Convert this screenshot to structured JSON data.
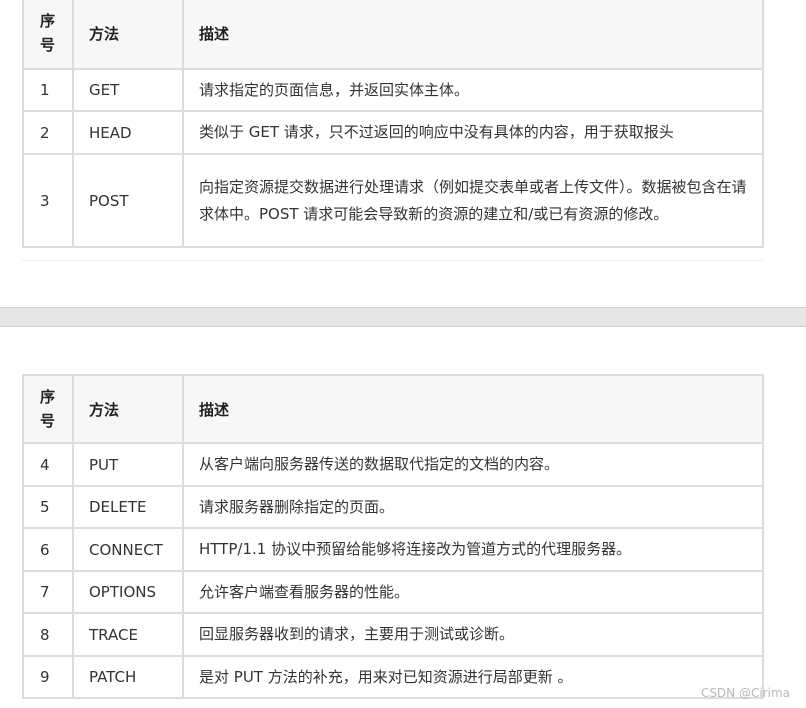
{
  "headers": {
    "num": "序号",
    "method": "方法",
    "desc": "描述"
  },
  "table1": {
    "rows": [
      {
        "num": "1",
        "method": "GET",
        "desc": "请求指定的页面信息，并返回实体主体。"
      },
      {
        "num": "2",
        "method": "HEAD",
        "desc": "类似于 GET 请求，只不过返回的响应中没有具体的内容，用于获取报头"
      },
      {
        "num": "3",
        "method": "POST",
        "desc": "向指定资源提交数据进行处理请求（例如提交表单或者上传文件）。数据被包含在请求体中。POST 请求可能会导致新的资源的建立和/或已有资源的修改。"
      }
    ]
  },
  "table2": {
    "rows": [
      {
        "num": "4",
        "method": "PUT",
        "desc": "从客户端向服务器传送的数据取代指定的文档的内容。"
      },
      {
        "num": "5",
        "method": "DELETE",
        "desc": "请求服务器删除指定的页面。"
      },
      {
        "num": "6",
        "method": "CONNECT",
        "desc": "HTTP/1.1 协议中预留给能够将连接改为管道方式的代理服务器。"
      },
      {
        "num": "7",
        "method": "OPTIONS",
        "desc": "允许客户端查看服务器的性能。"
      },
      {
        "num": "8",
        "method": "TRACE",
        "desc": "回显服务器收到的请求，主要用于测试或诊断。"
      },
      {
        "num": "9",
        "method": "PATCH",
        "desc": "是对 PUT 方法的补充，用来对已知资源进行局部更新 。"
      }
    ]
  },
  "watermark": "CSDN @Cirima"
}
